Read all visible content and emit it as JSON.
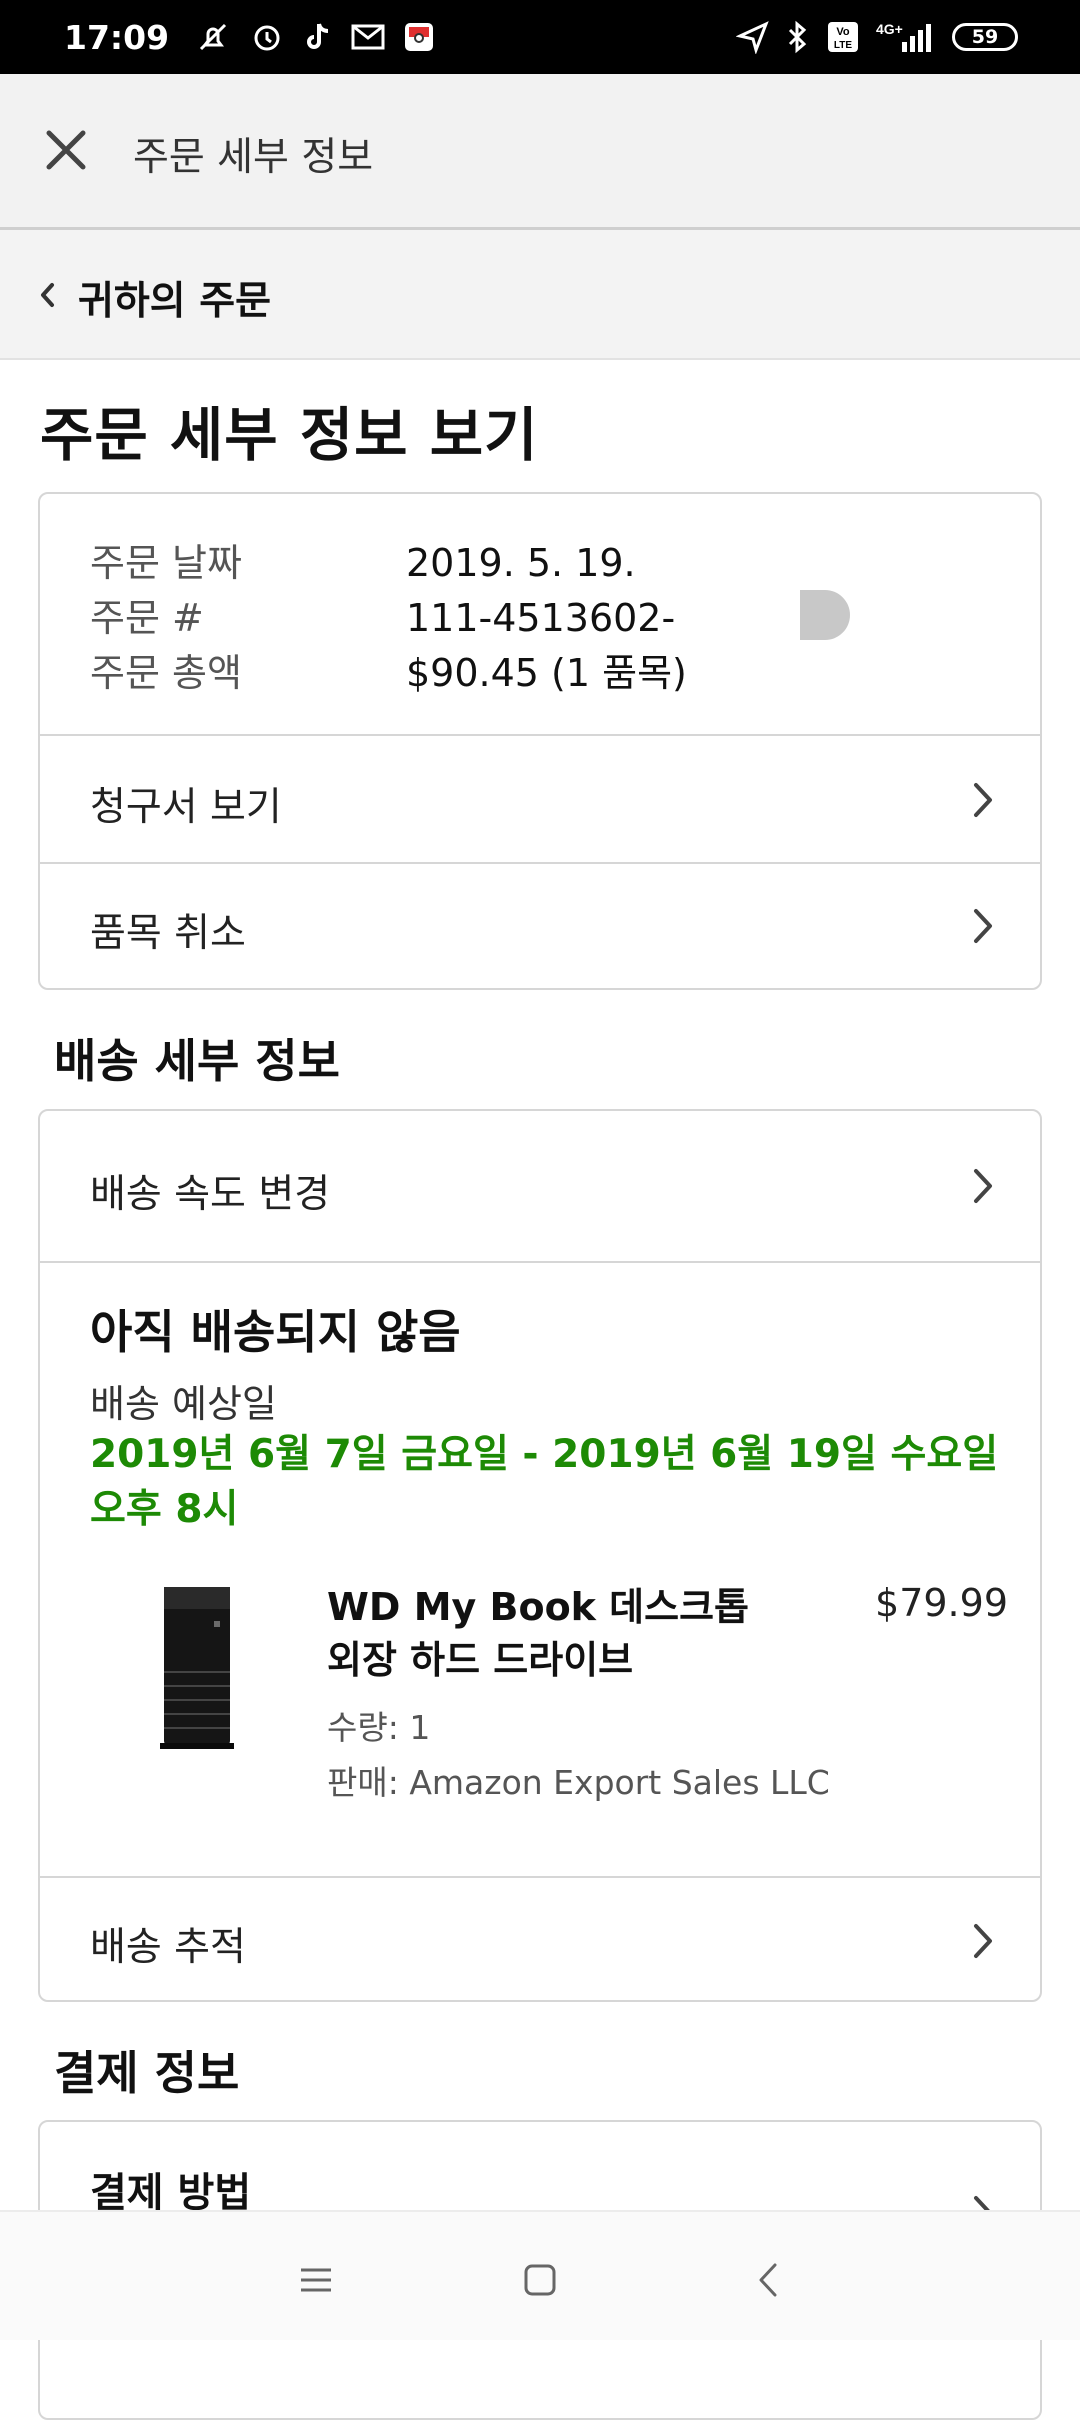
{
  "status_bar": {
    "time": "17:09",
    "battery": "59",
    "network": "4G+"
  },
  "top_bar": {
    "title": "주문 세부 정보"
  },
  "breadcrumb": {
    "label": "귀하의 주문"
  },
  "page_title": "주문 세부 정보 보기",
  "order_summary": {
    "date_label": "주문 날짜",
    "date_value": "2019. 5. 19.",
    "number_label": "주문 #",
    "number_value": "111-4513602-",
    "total_label": "주문 총액",
    "total_value": "$90.45 (1 품목)"
  },
  "order_actions": {
    "invoice": "청구서 보기",
    "cancel": "품목 취소"
  },
  "shipping": {
    "heading": "배송 세부 정보",
    "change_speed": "배송 속도 변경",
    "status": "아직 배송되지 않음",
    "eta_label": "배송 예상일",
    "eta_date": "2019년 6월 7일 금요일 - 2019년 6월 19일 수요일 오후 8시",
    "track": "배송 추적"
  },
  "item": {
    "name": "WD My Book 데스크톱 외장 하드 드라이브",
    "price": "$79.99",
    "quantity": "수량: 1",
    "seller": "판매: Amazon Export Sales LLC"
  },
  "payment": {
    "heading": "결제 정보",
    "method_label": "결제 방법"
  },
  "colors": {
    "eta_green": "#1d8a05",
    "border": "#d6d6d6"
  }
}
